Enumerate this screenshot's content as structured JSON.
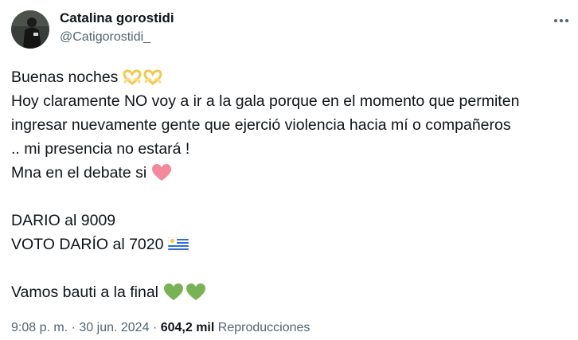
{
  "author": {
    "display_name": "Catalina gorostidi",
    "handle": "@Catigorostidi_",
    "avatar_icon": "profile-avatar"
  },
  "menu": {
    "icon": "more-dots-icon",
    "glyph": "···"
  },
  "tweet": {
    "line1": "Buenas noches",
    "line1_emojis": [
      "heart-hands-emoji",
      "heart-hands-emoji"
    ],
    "line2": "Hoy claramente NO voy a ir a la gala porque en el momento que permiten",
    "line3": "ingresar nuevamente gente que ejerció violencia hacia mí o compañeros",
    "line4": ".. mi presencia no estará !",
    "line5": "Mna en el debate si",
    "line5_emoji": "pink-heart-emoji",
    "line6": "DARIO al 9009",
    "line7": "VOTO DARÍO al 7020",
    "line7_emoji": "uruguay-flag-emoji",
    "line8": "Vamos bauti a la final",
    "line8_emojis": [
      "green-heart-emoji",
      "green-heart-emoji"
    ]
  },
  "meta": {
    "time": "9:08 p. m.",
    "separator": "·",
    "date": "30 jun. 2024",
    "views_count": "604,2 mil",
    "views_label": "Reproducciones"
  },
  "colors": {
    "text_primary": "#0f1419",
    "text_secondary": "#536471",
    "heart_pink": "#f4899b",
    "heart_green": "#77b255",
    "heart_hands": "#ffd983"
  }
}
